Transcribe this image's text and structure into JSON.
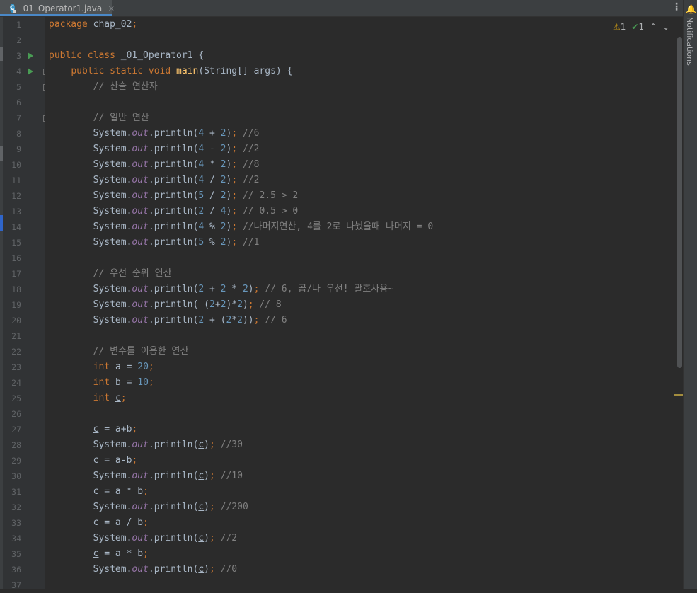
{
  "tab": {
    "filename": "_01_Operator1.java",
    "close": "×",
    "file_icon": "c-class-icon"
  },
  "tab_menu": "⋮",
  "inspection": {
    "warnings": "1",
    "weak_warnings": "1",
    "up": "⌃",
    "down": "⌄"
  },
  "notifications": {
    "label": "Notifications",
    "icon": "bell-icon"
  },
  "gutter": {
    "line_numbers": [
      "1",
      "2",
      "3",
      "4",
      "5",
      "6",
      "7",
      "8",
      "9",
      "10",
      "11",
      "12",
      "13",
      "14",
      "15",
      "16",
      "17",
      "18",
      "19",
      "20",
      "21",
      "22",
      "23",
      "24",
      "25",
      "26",
      "27",
      "28",
      "29",
      "30",
      "31",
      "32",
      "33",
      "34",
      "35",
      "36",
      "37"
    ],
    "run_lines": [
      3,
      4
    ],
    "fold_lines": [
      4,
      5,
      7
    ]
  },
  "code": [
    [
      [
        "kw",
        "package "
      ],
      [
        "",
        "chap_02"
      ],
      [
        "kw",
        ";"
      ]
    ],
    [],
    [
      [
        "kw",
        "public class "
      ],
      [
        "",
        "_01_Operator1 {"
      ]
    ],
    [
      [
        "",
        "    "
      ],
      [
        "kw",
        "public static void "
      ],
      [
        "fn",
        "main"
      ],
      [
        "",
        "(String[] args) {"
      ]
    ],
    [
      [
        "",
        "        "
      ],
      [
        "cm",
        "// 산술 연산자"
      ]
    ],
    [],
    [
      [
        "",
        "        "
      ],
      [
        "cm",
        "// 일반 연산"
      ]
    ],
    [
      [
        "",
        "        System."
      ],
      [
        "fld",
        "out"
      ],
      [
        "",
        ".println("
      ],
      [
        "num",
        "4"
      ],
      [
        "",
        " + "
      ],
      [
        "num",
        "2"
      ],
      [
        "",
        ")"
      ],
      [
        "kw",
        ";"
      ],
      [
        "cm",
        " //6"
      ]
    ],
    [
      [
        "",
        "        System."
      ],
      [
        "fld",
        "out"
      ],
      [
        "",
        ".println("
      ],
      [
        "num",
        "4"
      ],
      [
        "",
        " - "
      ],
      [
        "num",
        "2"
      ],
      [
        "",
        ")"
      ],
      [
        "kw",
        ";"
      ],
      [
        "cm",
        " //2"
      ]
    ],
    [
      [
        "",
        "        System."
      ],
      [
        "fld",
        "out"
      ],
      [
        "",
        ".println("
      ],
      [
        "num",
        "4"
      ],
      [
        "",
        " * "
      ],
      [
        "num",
        "2"
      ],
      [
        "",
        ")"
      ],
      [
        "kw",
        ";"
      ],
      [
        "cm",
        " //8"
      ]
    ],
    [
      [
        "",
        "        System."
      ],
      [
        "fld",
        "out"
      ],
      [
        "",
        ".println("
      ],
      [
        "num",
        "4"
      ],
      [
        "",
        " / "
      ],
      [
        "num",
        "2"
      ],
      [
        "",
        ")"
      ],
      [
        "kw",
        ";"
      ],
      [
        "cm",
        " //2"
      ]
    ],
    [
      [
        "",
        "        System."
      ],
      [
        "fld",
        "out"
      ],
      [
        "",
        ".println("
      ],
      [
        "num",
        "5"
      ],
      [
        "",
        " / "
      ],
      [
        "num",
        "2"
      ],
      [
        "",
        ")"
      ],
      [
        "kw",
        ";"
      ],
      [
        "cm",
        " // 2.5 > 2"
      ]
    ],
    [
      [
        "",
        "        System."
      ],
      [
        "fld",
        "out"
      ],
      [
        "",
        ".println("
      ],
      [
        "num",
        "2"
      ],
      [
        "",
        " / "
      ],
      [
        "num",
        "4"
      ],
      [
        "",
        ")"
      ],
      [
        "kw",
        ";"
      ],
      [
        "cm",
        " // 0.5 > 0"
      ]
    ],
    [
      [
        "",
        "        System."
      ],
      [
        "fld",
        "out"
      ],
      [
        "",
        ".println("
      ],
      [
        "num",
        "4"
      ],
      [
        "",
        " % "
      ],
      [
        "num",
        "2"
      ],
      [
        "",
        ")"
      ],
      [
        "kw",
        ";"
      ],
      [
        "cm",
        " //나머지연산, 4를 2로 나눴을때 나머지 = 0"
      ]
    ],
    [
      [
        "",
        "        System."
      ],
      [
        "fld",
        "out"
      ],
      [
        "",
        ".println("
      ],
      [
        "num",
        "5"
      ],
      [
        "",
        " % "
      ],
      [
        "num",
        "2"
      ],
      [
        "",
        ")"
      ],
      [
        "kw",
        ";"
      ],
      [
        "cm",
        " //1"
      ]
    ],
    [],
    [
      [
        "",
        "        "
      ],
      [
        "cm",
        "// 우선 순위 연산"
      ]
    ],
    [
      [
        "",
        "        System."
      ],
      [
        "fld",
        "out"
      ],
      [
        "",
        ".println("
      ],
      [
        "num",
        "2"
      ],
      [
        "",
        " + "
      ],
      [
        "num",
        "2"
      ],
      [
        "",
        " * "
      ],
      [
        "num",
        "2"
      ],
      [
        "",
        ")"
      ],
      [
        "kw",
        ";"
      ],
      [
        "cm",
        " // 6, 곱/나 우선! 괄호사용~"
      ]
    ],
    [
      [
        "",
        "        System."
      ],
      [
        "fld",
        "out"
      ],
      [
        "",
        ".println( ("
      ],
      [
        "num",
        "2"
      ],
      [
        "",
        "+"
      ],
      [
        "num",
        "2"
      ],
      [
        "",
        ")*"
      ],
      [
        "num",
        "2"
      ],
      [
        "",
        ")"
      ],
      [
        "kw",
        ";"
      ],
      [
        "cm",
        " // 8"
      ]
    ],
    [
      [
        "",
        "        System."
      ],
      [
        "fld",
        "out"
      ],
      [
        "",
        ".println("
      ],
      [
        "num",
        "2"
      ],
      [
        "",
        " + ("
      ],
      [
        "num",
        "2"
      ],
      [
        "",
        "*"
      ],
      [
        "num",
        "2"
      ],
      [
        "",
        "))"
      ],
      [
        "kw",
        ";"
      ],
      [
        "cm",
        " // 6"
      ]
    ],
    [],
    [
      [
        "",
        "        "
      ],
      [
        "cm",
        "// 변수를 이용한 연산"
      ]
    ],
    [
      [
        "",
        "        "
      ],
      [
        "kw",
        "int "
      ],
      [
        "",
        "a = "
      ],
      [
        "num",
        "20"
      ],
      [
        "kw",
        ";"
      ]
    ],
    [
      [
        "",
        "        "
      ],
      [
        "kw",
        "int "
      ],
      [
        "",
        "b = "
      ],
      [
        "num",
        "10"
      ],
      [
        "kw",
        ";"
      ]
    ],
    [
      [
        "",
        "        "
      ],
      [
        "kw",
        "int "
      ],
      [
        "ul",
        "c"
      ],
      [
        "kw",
        ";"
      ]
    ],
    [],
    [
      [
        "",
        "        "
      ],
      [
        "ul",
        "c"
      ],
      [
        "",
        " = a+b"
      ],
      [
        "kw",
        ";"
      ]
    ],
    [
      [
        "",
        "        System."
      ],
      [
        "fld",
        "out"
      ],
      [
        "",
        ".println("
      ],
      [
        "ul",
        "c"
      ],
      [
        "",
        ")"
      ],
      [
        "kw",
        ";"
      ],
      [
        "cm",
        " //30"
      ]
    ],
    [
      [
        "",
        "        "
      ],
      [
        "ul",
        "c"
      ],
      [
        "",
        " = a-b"
      ],
      [
        "kw",
        ";"
      ]
    ],
    [
      [
        "",
        "        System."
      ],
      [
        "fld",
        "out"
      ],
      [
        "",
        ".println("
      ],
      [
        "ul",
        "c"
      ],
      [
        "",
        ")"
      ],
      [
        "kw",
        ";"
      ],
      [
        "cm",
        " //10"
      ]
    ],
    [
      [
        "",
        "        "
      ],
      [
        "ul",
        "c"
      ],
      [
        "",
        " = a * b"
      ],
      [
        "kw",
        ";"
      ]
    ],
    [
      [
        "",
        "        System."
      ],
      [
        "fld",
        "out"
      ],
      [
        "",
        ".println("
      ],
      [
        "ul",
        "c"
      ],
      [
        "",
        ")"
      ],
      [
        "kw",
        ";"
      ],
      [
        "cm",
        " //200"
      ]
    ],
    [
      [
        "",
        "        "
      ],
      [
        "ul",
        "c"
      ],
      [
        "",
        " = a / b"
      ],
      [
        "kw",
        ";"
      ]
    ],
    [
      [
        "",
        "        System."
      ],
      [
        "fld",
        "out"
      ],
      [
        "",
        ".println("
      ],
      [
        "ul",
        "c"
      ],
      [
        "",
        ")"
      ],
      [
        "kw",
        ";"
      ],
      [
        "cm",
        " //2"
      ]
    ],
    [
      [
        "",
        "        "
      ],
      [
        "ul",
        "c"
      ],
      [
        "",
        " = a * b"
      ],
      [
        "kw",
        ";"
      ]
    ],
    [
      [
        "",
        "        System."
      ],
      [
        "fld",
        "out"
      ],
      [
        "",
        ".println("
      ],
      [
        "ul",
        "c"
      ],
      [
        "",
        ")"
      ],
      [
        "kw",
        ";"
      ],
      [
        "cm",
        " //0"
      ]
    ],
    []
  ]
}
